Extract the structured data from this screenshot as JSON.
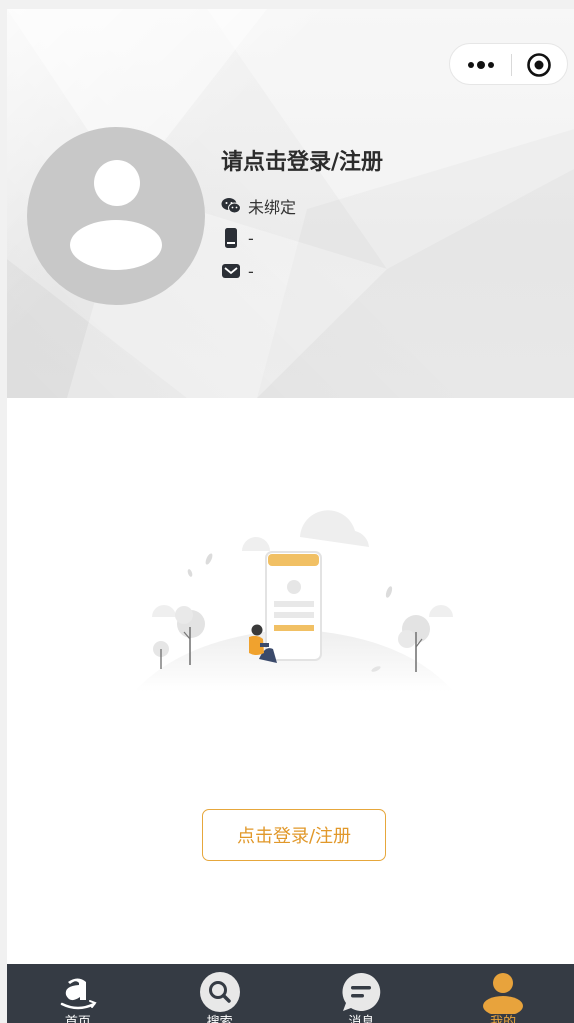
{
  "header": {
    "title": "请点击登录/注册",
    "wechat_status": "未绑定",
    "phone": "-",
    "email": "-"
  },
  "icons": {
    "more": "more-dots-icon",
    "close": "capsule-target-icon",
    "wechat": "wechat-icon",
    "phone": "phone-icon",
    "email": "mail-icon"
  },
  "main": {
    "login_button": "点击登录/注册"
  },
  "tabbar": {
    "items": [
      {
        "label": "首页",
        "icon": "amazon-a-icon",
        "active": false
      },
      {
        "label": "搜索",
        "icon": "search-icon",
        "active": false
      },
      {
        "label": "消息",
        "icon": "message-icon",
        "active": false
      },
      {
        "label": "我的",
        "icon": "user-icon",
        "active": true
      }
    ]
  },
  "colors": {
    "accent": "#e6a73c",
    "tabbar_bg": "#353b44",
    "avatar_bg": "#c8c8c8"
  }
}
